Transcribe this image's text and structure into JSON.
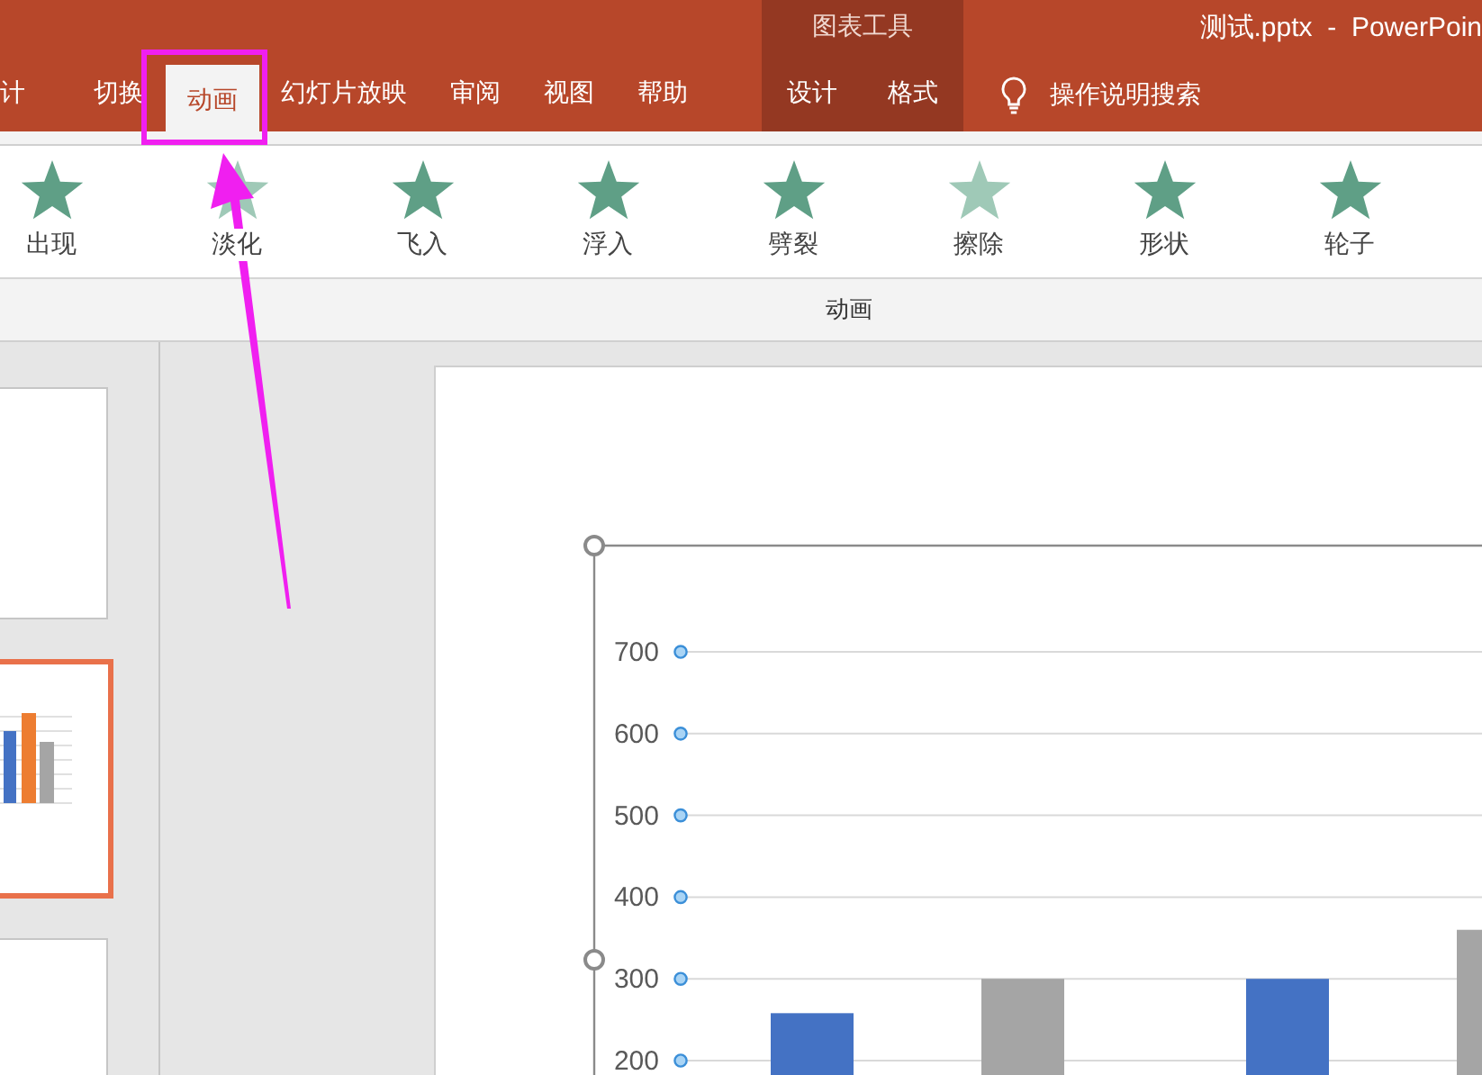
{
  "title": "测试.pptx  -  PowerPoin",
  "tabs": [
    {
      "label": "计",
      "selected": false
    },
    {
      "label": "切换",
      "selected": false
    },
    {
      "label": "动画",
      "selected": true
    },
    {
      "label": "幻灯片放映",
      "selected": false
    },
    {
      "label": "审阅",
      "selected": false
    },
    {
      "label": "视图",
      "selected": false
    },
    {
      "label": "帮助",
      "selected": false
    }
  ],
  "context_group": {
    "label": "图表工具",
    "tabs": [
      {
        "label": "设计",
        "selected": false
      },
      {
        "label": "格式",
        "selected": false
      }
    ]
  },
  "search": {
    "placeholder": "操作说明搜索"
  },
  "ribbon": {
    "effects": [
      {
        "label": "出现"
      },
      {
        "label": "淡化"
      },
      {
        "label": "飞入"
      },
      {
        "label": "浮入"
      },
      {
        "label": "劈裂"
      },
      {
        "label": "擦除"
      },
      {
        "label": "形状"
      },
      {
        "label": "轮子"
      }
    ],
    "group_label": "动画"
  },
  "slides": [
    {
      "selected": false
    },
    {
      "selected": true
    },
    {
      "selected": false
    }
  ],
  "chart": {
    "chart_data": {
      "type": "bar",
      "stacked": false,
      "grid": true,
      "ylim": [
        200,
        830
      ],
      "yticks": [
        200,
        300,
        400,
        500,
        600,
        700
      ],
      "series": [
        {
          "color": "#4472c4",
          "values": [
            258,
            300
          ]
        },
        {
          "color": "#a5a5a5",
          "values": [
            300,
            360
          ]
        }
      ]
    }
  }
}
